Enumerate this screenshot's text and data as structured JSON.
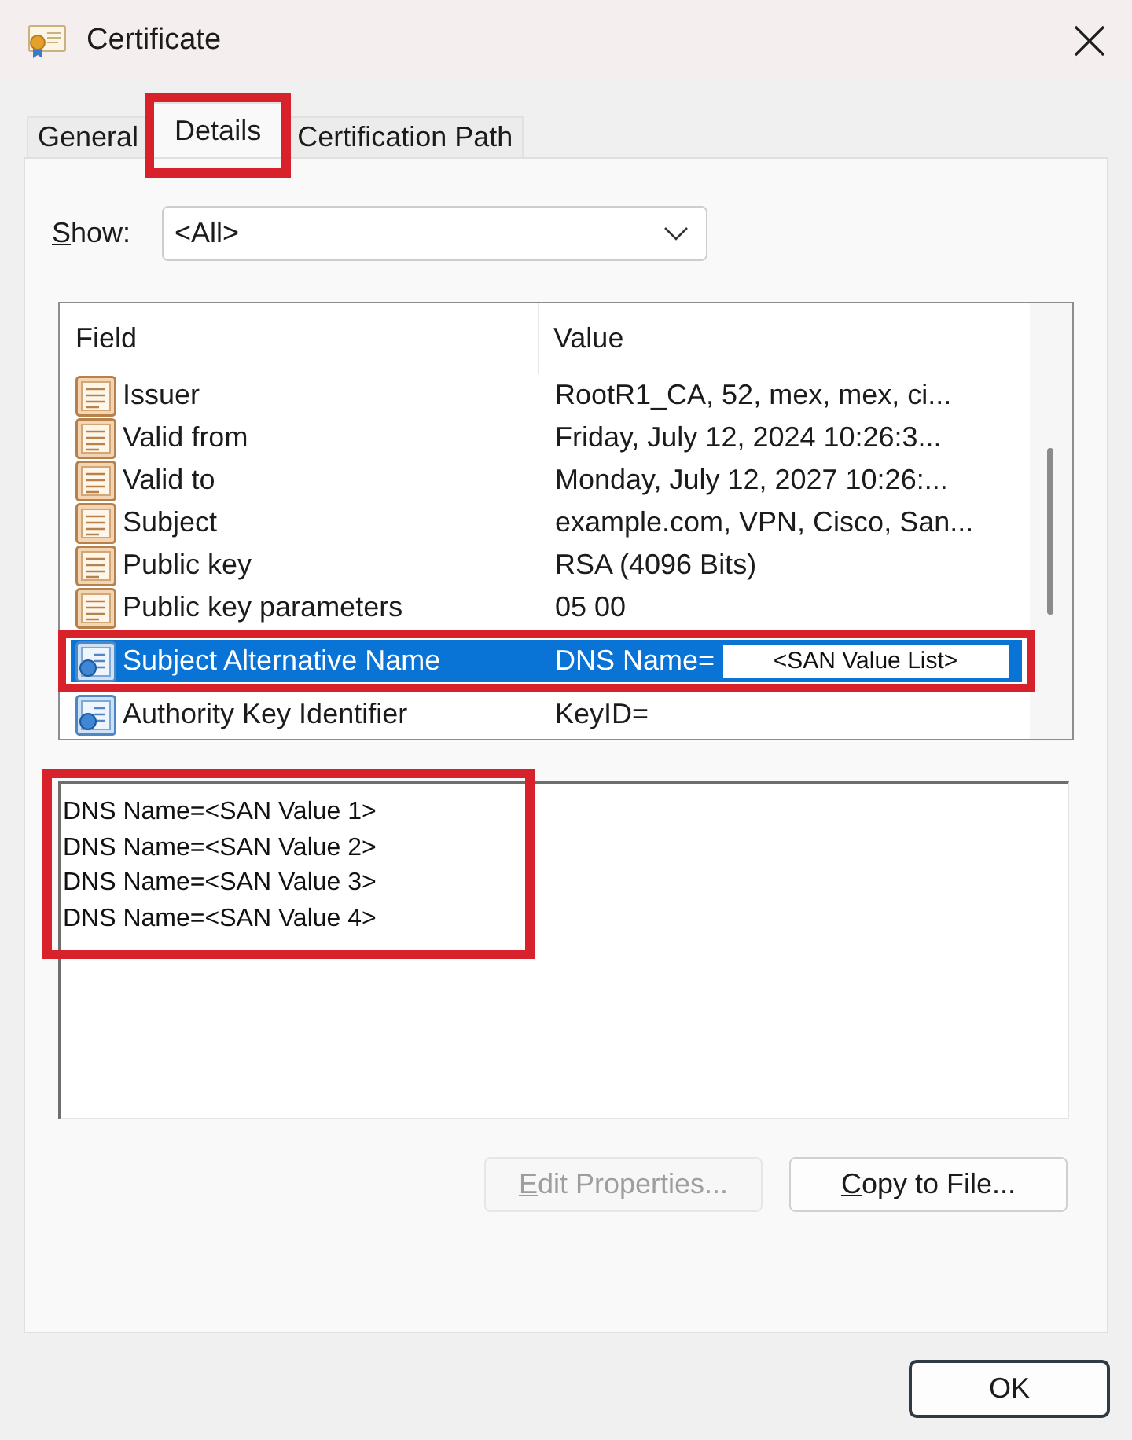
{
  "window": {
    "title": "Certificate"
  },
  "tabs": [
    {
      "label": "General",
      "selected": false,
      "highlighted": false
    },
    {
      "label": "Details",
      "selected": true,
      "highlighted": true
    },
    {
      "label": "Certification Path",
      "selected": false,
      "highlighted": false
    }
  ],
  "show": {
    "label": "Show:",
    "access_key_underlined": true,
    "value": "<All>"
  },
  "fields_list": {
    "columns": [
      "Field",
      "Value"
    ],
    "rows": [
      {
        "kind": "property",
        "field": "Issuer",
        "value": "RootR1_CA, 52, mex, mex, ci...",
        "selected": false,
        "highlighted": false
      },
      {
        "kind": "property",
        "field": "Valid from",
        "value": "Friday, July 12, 2024 10:26:3...",
        "selected": false,
        "highlighted": false
      },
      {
        "kind": "property",
        "field": "Valid to",
        "value": "Monday, July 12, 2027 10:26:...",
        "selected": false,
        "highlighted": false
      },
      {
        "kind": "property",
        "field": "Subject",
        "value": "example.com, VPN, Cisco, San...",
        "selected": false,
        "highlighted": false
      },
      {
        "kind": "property",
        "field": "Public key",
        "value": "RSA (4096 Bits)",
        "selected": false,
        "highlighted": false
      },
      {
        "kind": "property",
        "field": "Public key parameters",
        "value": "05 00",
        "selected": false,
        "highlighted": false
      },
      {
        "kind": "extension",
        "field": "Subject Alternative Name",
        "value": "DNS Name=",
        "value_overlay": "<SAN Value List>",
        "selected": true,
        "highlighted": true
      },
      {
        "kind": "extension",
        "field": "Authority Key Identifier",
        "value": "KeyID=",
        "selected": false,
        "highlighted": false
      }
    ]
  },
  "details": {
    "lines": [
      "DNS Name=<SAN Value 1>",
      "DNS Name=<SAN Value 2>",
      "DNS Name=<SAN Value 3>",
      "DNS Name=<SAN Value 4>"
    ],
    "highlighted": true
  },
  "buttons": [
    {
      "label": "Edit Properties...",
      "disabled": true,
      "access_key_underlined": true
    },
    {
      "label": "Copy to File...",
      "disabled": false,
      "access_key_underlined": true
    }
  ],
  "footer": {
    "ok_button": {
      "label": "OK",
      "default": true
    }
  }
}
